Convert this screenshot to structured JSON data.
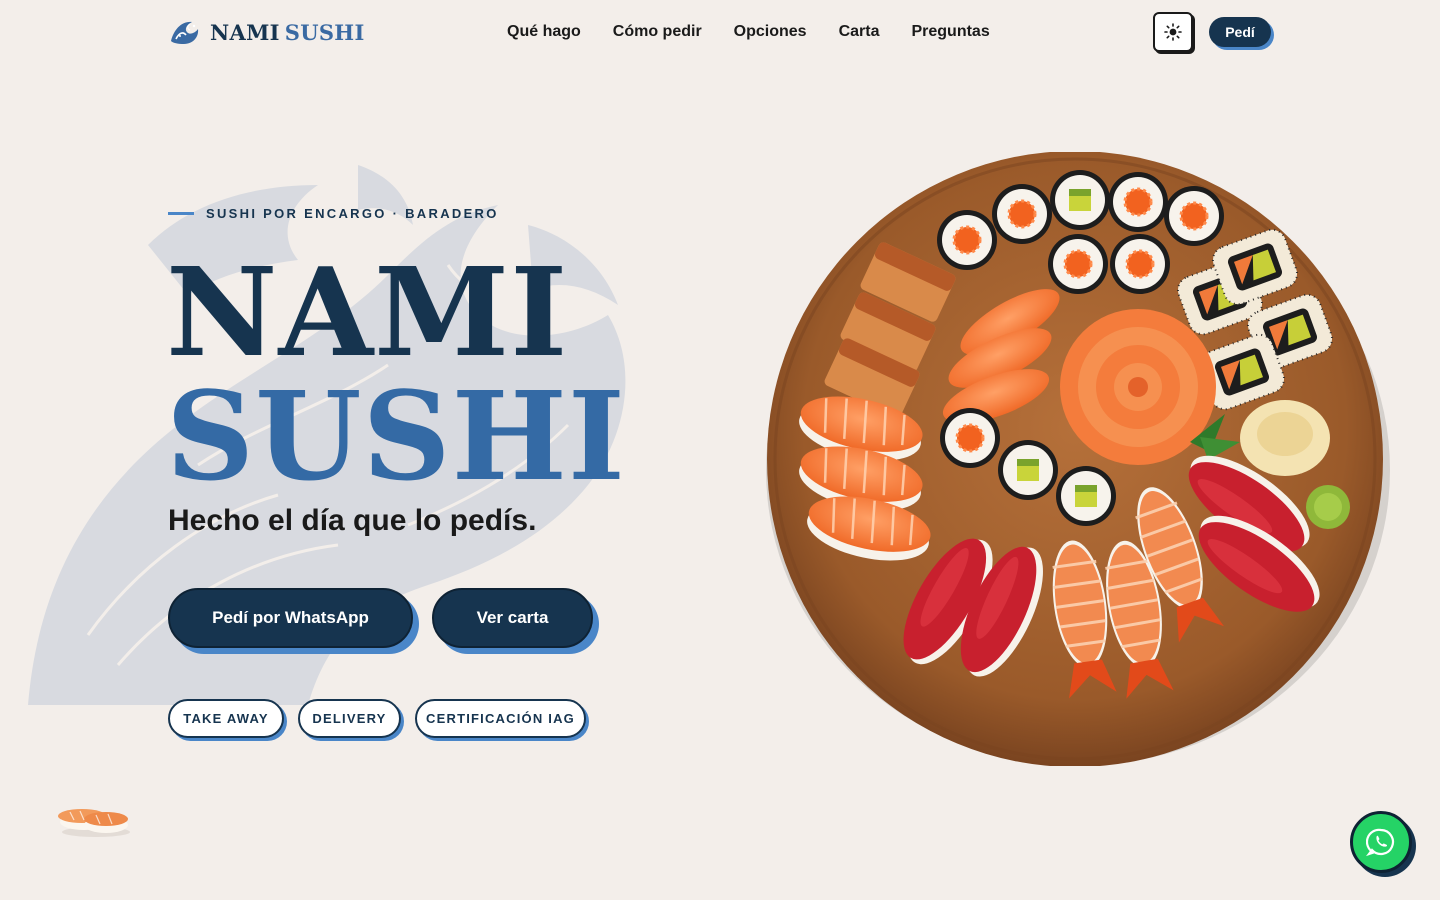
{
  "brand": {
    "name_part1": "NAMI",
    "name_part2": "SUSHI"
  },
  "nav": {
    "items": [
      {
        "label": "Qué hago"
      },
      {
        "label": "Cómo pedir"
      },
      {
        "label": "Opciones"
      },
      {
        "label": "Carta"
      },
      {
        "label": "Preguntas"
      }
    ],
    "theme_icon": "sun-icon",
    "order_label": "Pedí"
  },
  "hero": {
    "eyebrow": "SUSHI POR ENCARGO · BARADERO",
    "title_line1": "NAMI",
    "title_line2": "SUSHI",
    "tagline": "Hecho el día que lo pedís.",
    "cta_whatsapp": "Pedí por WhatsApp",
    "cta_menu": "Ver carta",
    "chips": [
      "TAKE AWAY",
      "DELIVERY",
      "CERTIFICACIÓN IAG"
    ]
  },
  "fab": {
    "icon": "whatsapp-icon"
  },
  "colors": {
    "background": "#f3eeea",
    "navy": "#16344f",
    "blue": "#346aa5",
    "accent_shadow": "#4a86c8",
    "whatsapp": "#25d366"
  }
}
